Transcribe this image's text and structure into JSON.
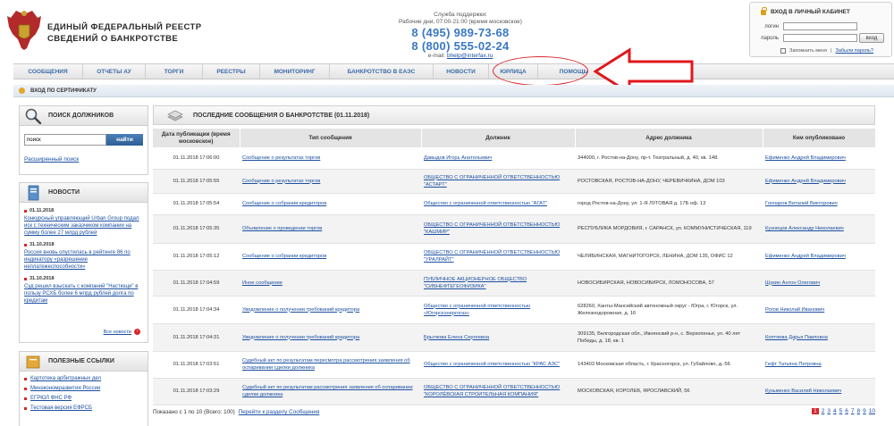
{
  "header": {
    "title_line1": "ЕДИНЫЙ ФЕДЕРАЛЬНЫЙ РЕЕСТР",
    "title_line2": "СВЕДЕНИЙ О БАНКРОТСТВЕ",
    "support_label": "Служба поддержки:",
    "support_hours": "Рабочие дни, 07:00-21:00 (время московское)",
    "phone1": "8 (495) 989-73-68",
    "phone2": "8 (800) 555-02-24",
    "email_label": "e-mail:",
    "email": "bhelp@interfax.ru"
  },
  "login": {
    "title": "ВХОД В ЛИЧНЫЙ КАБИНЕТ",
    "login_label": "логин",
    "password_label": "пароль",
    "button": "вход",
    "remember": "Запомнить меня",
    "forgot": "Забыли пароль?"
  },
  "nav": {
    "items": [
      {
        "label": "СООБЩЕНИЯ"
      },
      {
        "label": "ОТЧЕТЫ АУ"
      },
      {
        "label": "ТОРГИ"
      },
      {
        "label": "РЕЕСТРЫ"
      },
      {
        "label": "МОНИТОРИНГ"
      },
      {
        "label": "БАНКРОТСТВО В ЕАЭС"
      },
      {
        "label": "НОВОСТИ"
      },
      {
        "label": "ЮРЛИЦА"
      },
      {
        "label": "ПОМОЩЬ"
      }
    ],
    "cert_login": "ВХОД ПО СЕРТИФИКАТУ"
  },
  "sidebar": {
    "search_title": "ПОИСК ДОЛЖНИКОВ",
    "search_value": "поиск",
    "search_button": "найти",
    "advanced_search": "Расширенный поиск",
    "news_title": "НОВОСТИ",
    "news": [
      {
        "date": "01.11.2018",
        "text": "Конкурсный управляющий Urban Group подал иск с техническим заказчиком компании на сумму более 27 млрд рублей"
      },
      {
        "date": "31.10.2018",
        "text": "Россия вновь опустилась в рейтинге 86 по индикатору «разрешение неплатежеспособности»"
      },
      {
        "date": "31.10.2018",
        "text": "Суд решил взыскать с компаний \"Настющи\" в пользу РСХБ более 6 млрд рублей долга по кредитам"
      }
    ],
    "all_news": "Все новости",
    "links_title": "ПОЛЕЗНЫЕ ССЫЛКИ",
    "links": [
      "Картотека арбитражных дел",
      "Минэкономразвития России",
      "ЕГРЮЛ ФНС РФ",
      "Тестовая версия ЕФРСБ"
    ]
  },
  "main": {
    "title": "ПОСЛЕДНИЕ СООБЩЕНИЯ О БАНКРОТСТВЕ (01.11.2018)",
    "columns": [
      "Дата публикации (время московское)",
      "Тип сообщения",
      "Должник",
      "Адрес должника",
      "Кем опубликовано"
    ],
    "rows": [
      {
        "date": "01.11.2018 17:06:00",
        "type": "Сообщение о результатах торгов",
        "debtor": "Давыдов Игорь Анатольевич",
        "address": "344000, г. Ростов-на-Дону, пр-т. Театральный, д. 40, кв. 148.",
        "publisher": "Ефименко Андрей Владимирович"
      },
      {
        "date": "01.11.2018 17:05:55",
        "type": "Сообщение о результатах торгов",
        "debtor": "ОБЩЕСТВО С ОГРАНИЧЕННОЙ ОТВЕТСТВЕННОСТЬЮ \"АСТАРТ\"",
        "address": "РОСТОВСКАЯ, РОСТОВ-НА-ДОНУ, ЧЕРЕВИЧКИНА, ДОМ 103",
        "publisher": "Ефименко Андрей Владимирович"
      },
      {
        "date": "01.11.2018 17:05:54",
        "type": "Сообщение о собрании кредиторов",
        "debtor": "Общество с ограниченной ответственностью \"АГАТ\"",
        "address": "город Ростов-на-Дону, ул. 1-Я ЛУГОВАЯ д. 17Б оф. 13",
        "publisher": "Гончаров Виталий Викторович"
      },
      {
        "date": "01.11.2018 17:05:35",
        "type": "Объявление о проведении торгов",
        "debtor": "ОБЩЕСТВО С ОГРАНИЧЕННОЙ ОТВЕТСТВЕННОСТЬЮ \"КАШМИР\"",
        "address": "РЕСПУБЛИКА МОРДОВИЯ, г. САРАНСК, ул. КОММУНИСТИЧЕСКАЯ, 119",
        "publisher": "Кузнецов Александр Николаевич"
      },
      {
        "date": "01.11.2018 17:05:12",
        "type": "Сообщение о собрании кредиторов",
        "debtor": "ОБЩЕСТВО С ОГРАНИЧЕННОЙ ОТВЕТСТВЕННОСТЬЮ \"УРАЛРАЙТ\"",
        "address": "ЧЕЛЯБИНСКАЯ, МАГНИТОГОРСК, ЛЕНИНА, ДОМ 135, ОФИС 12",
        "publisher": "Ефименко Андрей Владимирович"
      },
      {
        "date": "01.11.2018 17:04:59",
        "type": "Иное сообщение",
        "debtor": "ПУБЛИЧНОЕ АКЦИОНЕРНОЕ ОБЩЕСТВО \"СИБНЕФТЕГЕОФИЗИКА\"",
        "address": "НОВОСИБИРСКАЯ, НОВОСИБИРСК, ЛОМОНОСОВА, 57",
        "publisher": "Щукин Антон Олегович"
      },
      {
        "date": "01.11.2018 17:04:34",
        "type": "Уведомление о получении требований кредитора",
        "debtor": "Общество с ограниченной ответственностью «Югорскэнергогаз»",
        "address": "628260, Ханты-Мансийский автономный округ - Югра, г. Югорск, ул. Железнодорожная, д. 16",
        "publisher": "Рогов Николай Иванович"
      },
      {
        "date": "01.11.2018 17:04:31",
        "type": "Уведомление о получении требований кредитора",
        "debtor": "Брыткова Елена Сергеевна",
        "address": "309135, Белгородская обл., Ивнянский р-н, с. Верхопенье, ул. 40 лет Победы, д. 18, кв. 1",
        "publisher": "Коптяева Дарья Павловна"
      },
      {
        "date": "01.11.2018 17:03:51",
        "type": "Судебный акт по результатам пересмотра рассмотрения заявления об оспаривании сделки должника",
        "debtor": "Общество с ограниченной ответственностью \"КРАС АЗС\"",
        "address": "143403 Московская область, г. Красногорск, ул. Губайлово, д.-56",
        "publisher": "Гефт Татьяна Петровна"
      },
      {
        "date": "01.11.2018 17:03:29",
        "type": "Судебный акт по результатам рассмотрения заявления об оспаривании сделки должника",
        "debtor": "ОБЩЕСТВО С ОГРАНИЧЕННОЙ ОТВЕТСТВЕННОСТЬЮ \"КОРОЛЁВСКАЯ СТРОИТЕЛЬНАЯ КОМПАНИЯ\"",
        "address": "МОСКОВСКАЯ, КОРОЛЕВ, ЯРОСЛАВСКИЙ, 56",
        "publisher": "Кузьменко Василий Николаевич"
      }
    ],
    "shown_text": "Показано с 1 по 10 (Всего: 100)",
    "go_to_section": "Перейти к разделу Сообщения",
    "pages": [
      "1",
      "2",
      "3",
      "4",
      "5",
      "6",
      "7",
      "8",
      "9",
      "10"
    ]
  },
  "colors": {
    "accent": "#3a78c4",
    "highlight": "#d9262a"
  }
}
